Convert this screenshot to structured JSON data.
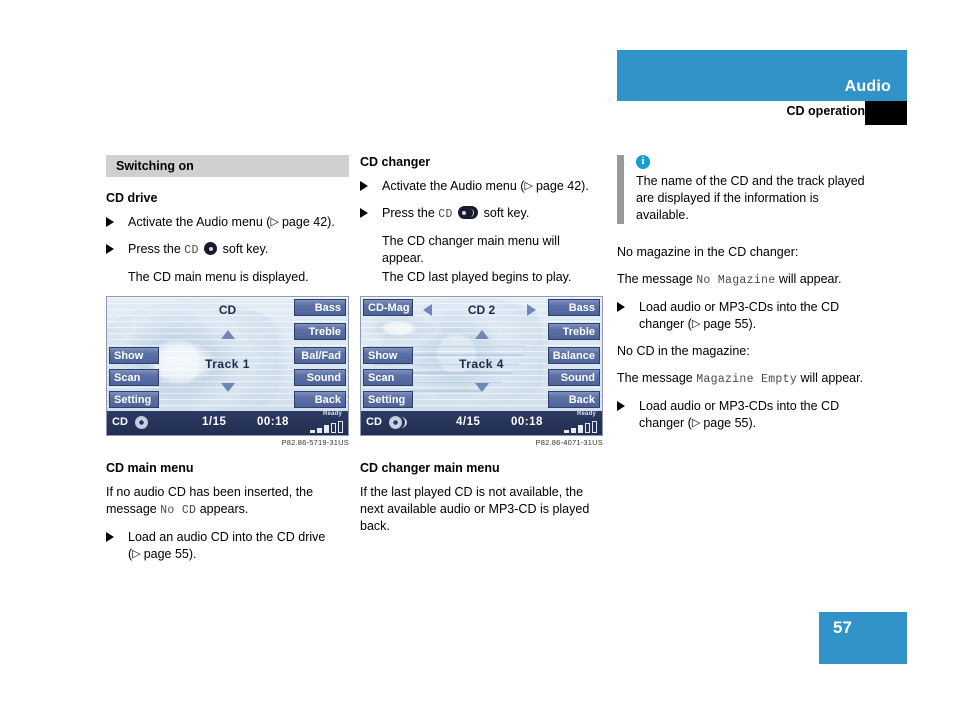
{
  "header": {
    "title": "Audio",
    "subtitle": "CD operation"
  },
  "page_number": "57",
  "col1": {
    "section_heading": "Switching on",
    "sub_heading": "CD drive",
    "step1": "Activate the Audio menu (",
    "step1_ref": "page 42).",
    "step2_pre": "Press the",
    "step2_key": "CD",
    "step2_post": "soft key.",
    "result": "The CD main menu is displayed.",
    "caption": "CD main menu",
    "image_code": "P82.86-5719-31US",
    "para1_a": "If no audio CD has been inserted, the message",
    "para1_mono": "No CD",
    "para1_b": "appears.",
    "step3": "Load an audio CD into the CD drive (",
    "step3_ref": "page 55).",
    "screen": {
      "title": "CD",
      "track": "Track 1",
      "left_buttons": [
        "Show",
        "Scan",
        "Setting"
      ],
      "right_buttons": [
        "Bass",
        "Treble",
        "Bal/Fad",
        "Sound",
        "Back"
      ],
      "status_source": "CD",
      "status_track": "1/15",
      "status_time": "00:18",
      "status_ready": "Ready"
    }
  },
  "col2": {
    "sub_heading": "CD changer",
    "step1": "Activate the Audio menu (",
    "step1_ref": "page 42).",
    "step2_pre": "Press the",
    "step2_key": "CD",
    "step2_post": "soft key.",
    "result1": "The CD changer main menu will appear.",
    "result2": "The CD last played begins to play.",
    "caption": "CD changer main menu",
    "image_code": "P82.86-4071-31US",
    "para1": "If the last played CD is not available, the next available audio or MP3-CD is played back.",
    "screen": {
      "magazine_button": "CD-Mag",
      "title": "CD 2",
      "track": "Track 4",
      "left_buttons": [
        "Show",
        "Scan",
        "Setting"
      ],
      "right_buttons": [
        "Bass",
        "Treble",
        "Balance",
        "Sound",
        "Back"
      ],
      "status_source": "CD",
      "status_track": "4/15",
      "status_time": "00:18",
      "status_ready": "Ready"
    }
  },
  "col3": {
    "info_icon": "info-icon",
    "info_text": "The name of the CD and the track played are displayed if the information is available.",
    "head1": "No magazine in the CD changer:",
    "msg1_a": "The message",
    "msg1_mono": "No Magazine",
    "msg1_b": "will appear.",
    "step1": "Load audio or MP3-CDs into the CD changer (",
    "step1_ref": "page 55).",
    "head2": "No CD in the magazine:",
    "msg2_a": "The message",
    "msg2_mono": "Magazine Empty",
    "msg2_b": "will appear.",
    "step2": "Load audio or MP3-CDs into the CD changer (",
    "step2_ref": "page 55)."
  },
  "colors": {
    "brand_blue": "#3193c8",
    "section_gray": "#d0d0d0",
    "info_blue": "#1b9ad6",
    "screen_button": "#5c71a6",
    "screen_statusbar": "#2c3a63"
  }
}
